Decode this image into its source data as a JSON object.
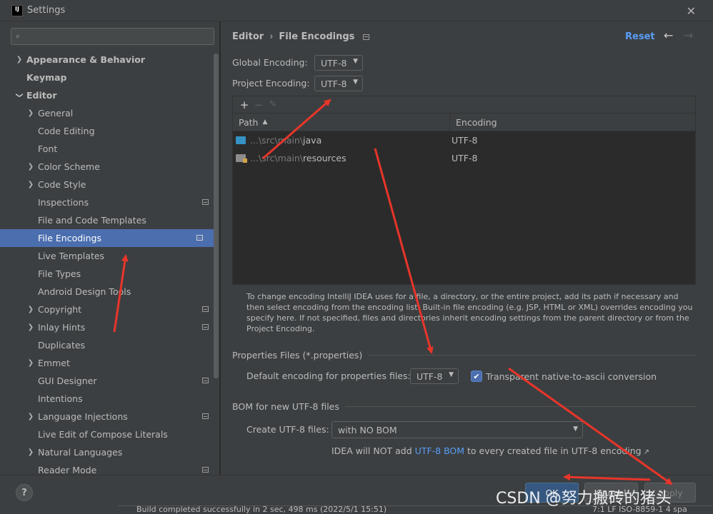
{
  "window": {
    "title": "Settings",
    "logo_text": "IJ",
    "close_glyph": "✕"
  },
  "search": {
    "placeholder": "Q▾",
    "value": ""
  },
  "tree": {
    "appearance": "Appearance & Behavior",
    "keymap": "Keymap",
    "editor": "Editor",
    "general": "General",
    "code_editing": "Code Editing",
    "font": "Font",
    "color_scheme": "Color Scheme",
    "code_style": "Code Style",
    "inspections": "Inspections",
    "file_code_templates": "File and Code Templates",
    "file_encodings": "File Encodings",
    "live_templates": "Live Templates",
    "file_types": "File Types",
    "android_design_tools": "Android Design Tools",
    "copyright": "Copyright",
    "inlay_hints": "Inlay Hints",
    "duplicates": "Duplicates",
    "emmet": "Emmet",
    "gui_designer": "GUI Designer",
    "intentions": "Intentions",
    "language_injections": "Language Injections",
    "live_edit_compose": "Live Edit of Compose Literals",
    "natural_languages": "Natural Languages",
    "reader_mode": "Reader Mode"
  },
  "breadcrumb": {
    "parent": "Editor",
    "separator": "›",
    "current": "File Encodings"
  },
  "header": {
    "reset": "Reset",
    "back_icon": "←",
    "forward_icon": "→"
  },
  "global_encoding": {
    "label": "Global Encoding:",
    "value": "UTF-8"
  },
  "project_encoding": {
    "label": "Project Encoding:",
    "value": "UTF-8"
  },
  "table": {
    "add": "+",
    "remove": "−",
    "edit": "✎",
    "col_path": "Path",
    "col_encoding": "Encoding",
    "rows": [
      {
        "prefix": "...\\src\\main\\",
        "name": "java",
        "encoding": "UTF-8"
      },
      {
        "prefix": "...\\src\\main\\",
        "name": "resources",
        "encoding": "UTF-8"
      }
    ]
  },
  "help_text": "To change encoding IntelliJ IDEA uses for a file, a directory, or the entire project, add its path if necessary and then select encoding from the encoding list. Built-in file encoding (e.g. JSP, HTML or XML) overrides encoding you specify here. If not specified, files and directories inherit encoding settings from the parent directory or from the Project Encoding.",
  "properties": {
    "section": "Properties Files (*.properties)",
    "default_label": "Default encoding for properties files:",
    "default_value": "UTF-8",
    "checkbox_label": "Transparent native-to-ascii conversion",
    "checkbox_checked": true
  },
  "bom": {
    "section": "BOM for new UTF-8 files",
    "create_label": "Create UTF-8 files:",
    "create_value": "with NO BOM",
    "note_prefix": "IDEA will NOT add ",
    "note_link": "UTF-8 BOM",
    "note_suffix": " to every created file in UTF-8 encoding",
    "note_arrow": "↗"
  },
  "footer": {
    "help": "?",
    "ok": "OK",
    "cancel": "Cancel",
    "apply": "Apply"
  },
  "statusbar": {
    "message": "Build completed successfully in 2 sec, 498 ms (2022/5/1 15:51)",
    "position": "7:1   LF   ISO-8859-1   4 spa"
  },
  "watermark": "CSDN @努力搬砖的猪头",
  "colors": {
    "accent": "#4b6eaf",
    "link": "#589df6",
    "annotation": "#e8352a",
    "panel": "#3c3f41"
  }
}
